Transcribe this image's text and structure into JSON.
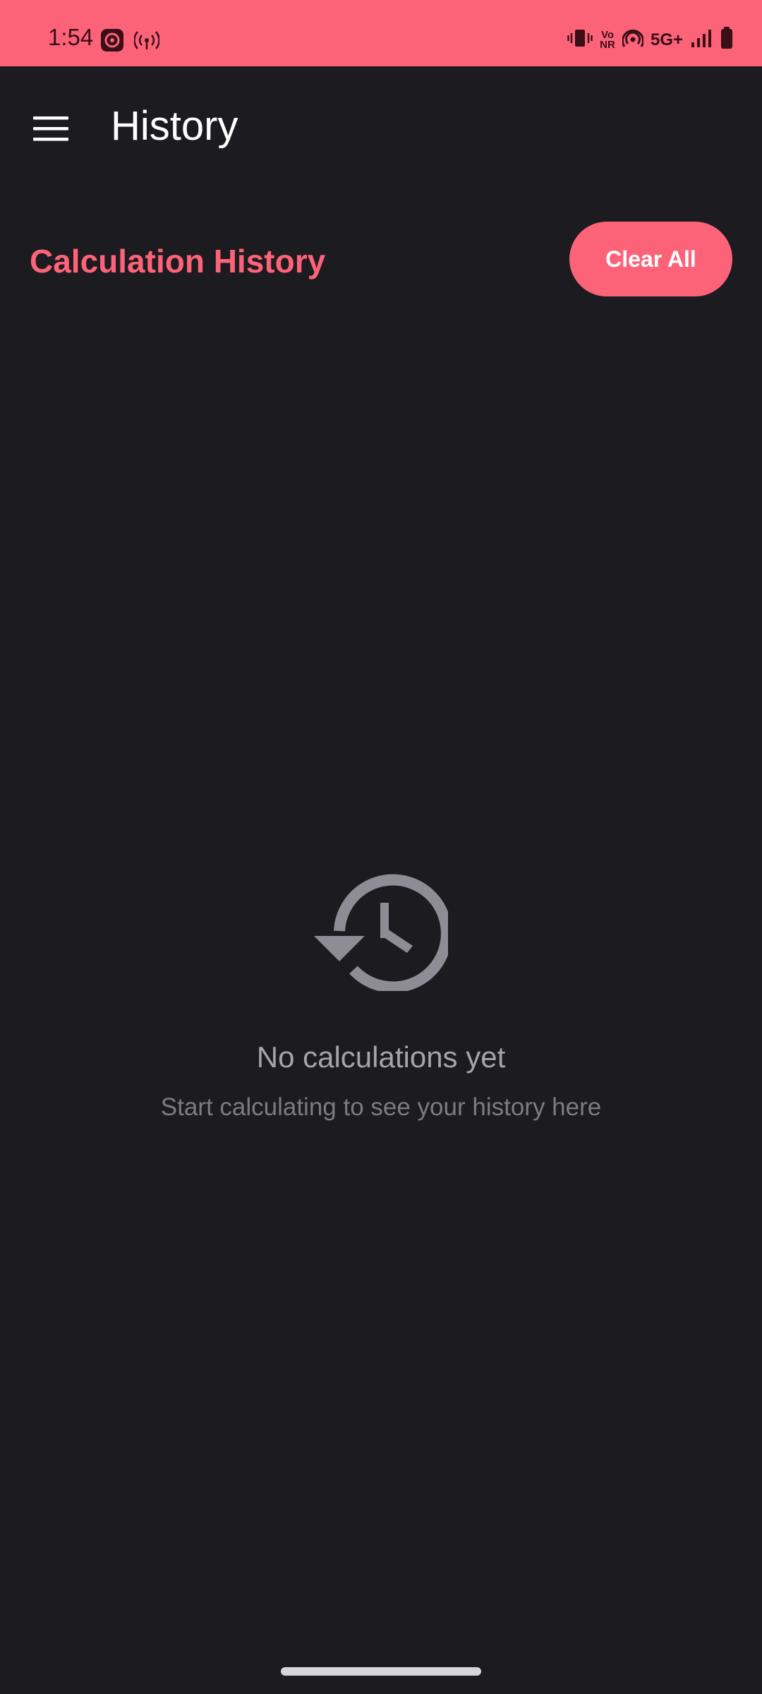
{
  "status_bar": {
    "time": "1:54",
    "network": "5G+",
    "volte": "Vo NR",
    "background_color": "#fd6378"
  },
  "app_bar": {
    "title": "History",
    "menu_icon": "hamburger-menu-icon"
  },
  "section": {
    "title": "Calculation History",
    "clear_label": "Clear All"
  },
  "empty_state": {
    "icon": "history-icon",
    "title": "No calculations yet",
    "subtitle": "Start calculating to see your history here"
  },
  "colors": {
    "accent": "#fd6378",
    "background": "#1c1b1f",
    "muted_text": "#a6a4ab"
  }
}
